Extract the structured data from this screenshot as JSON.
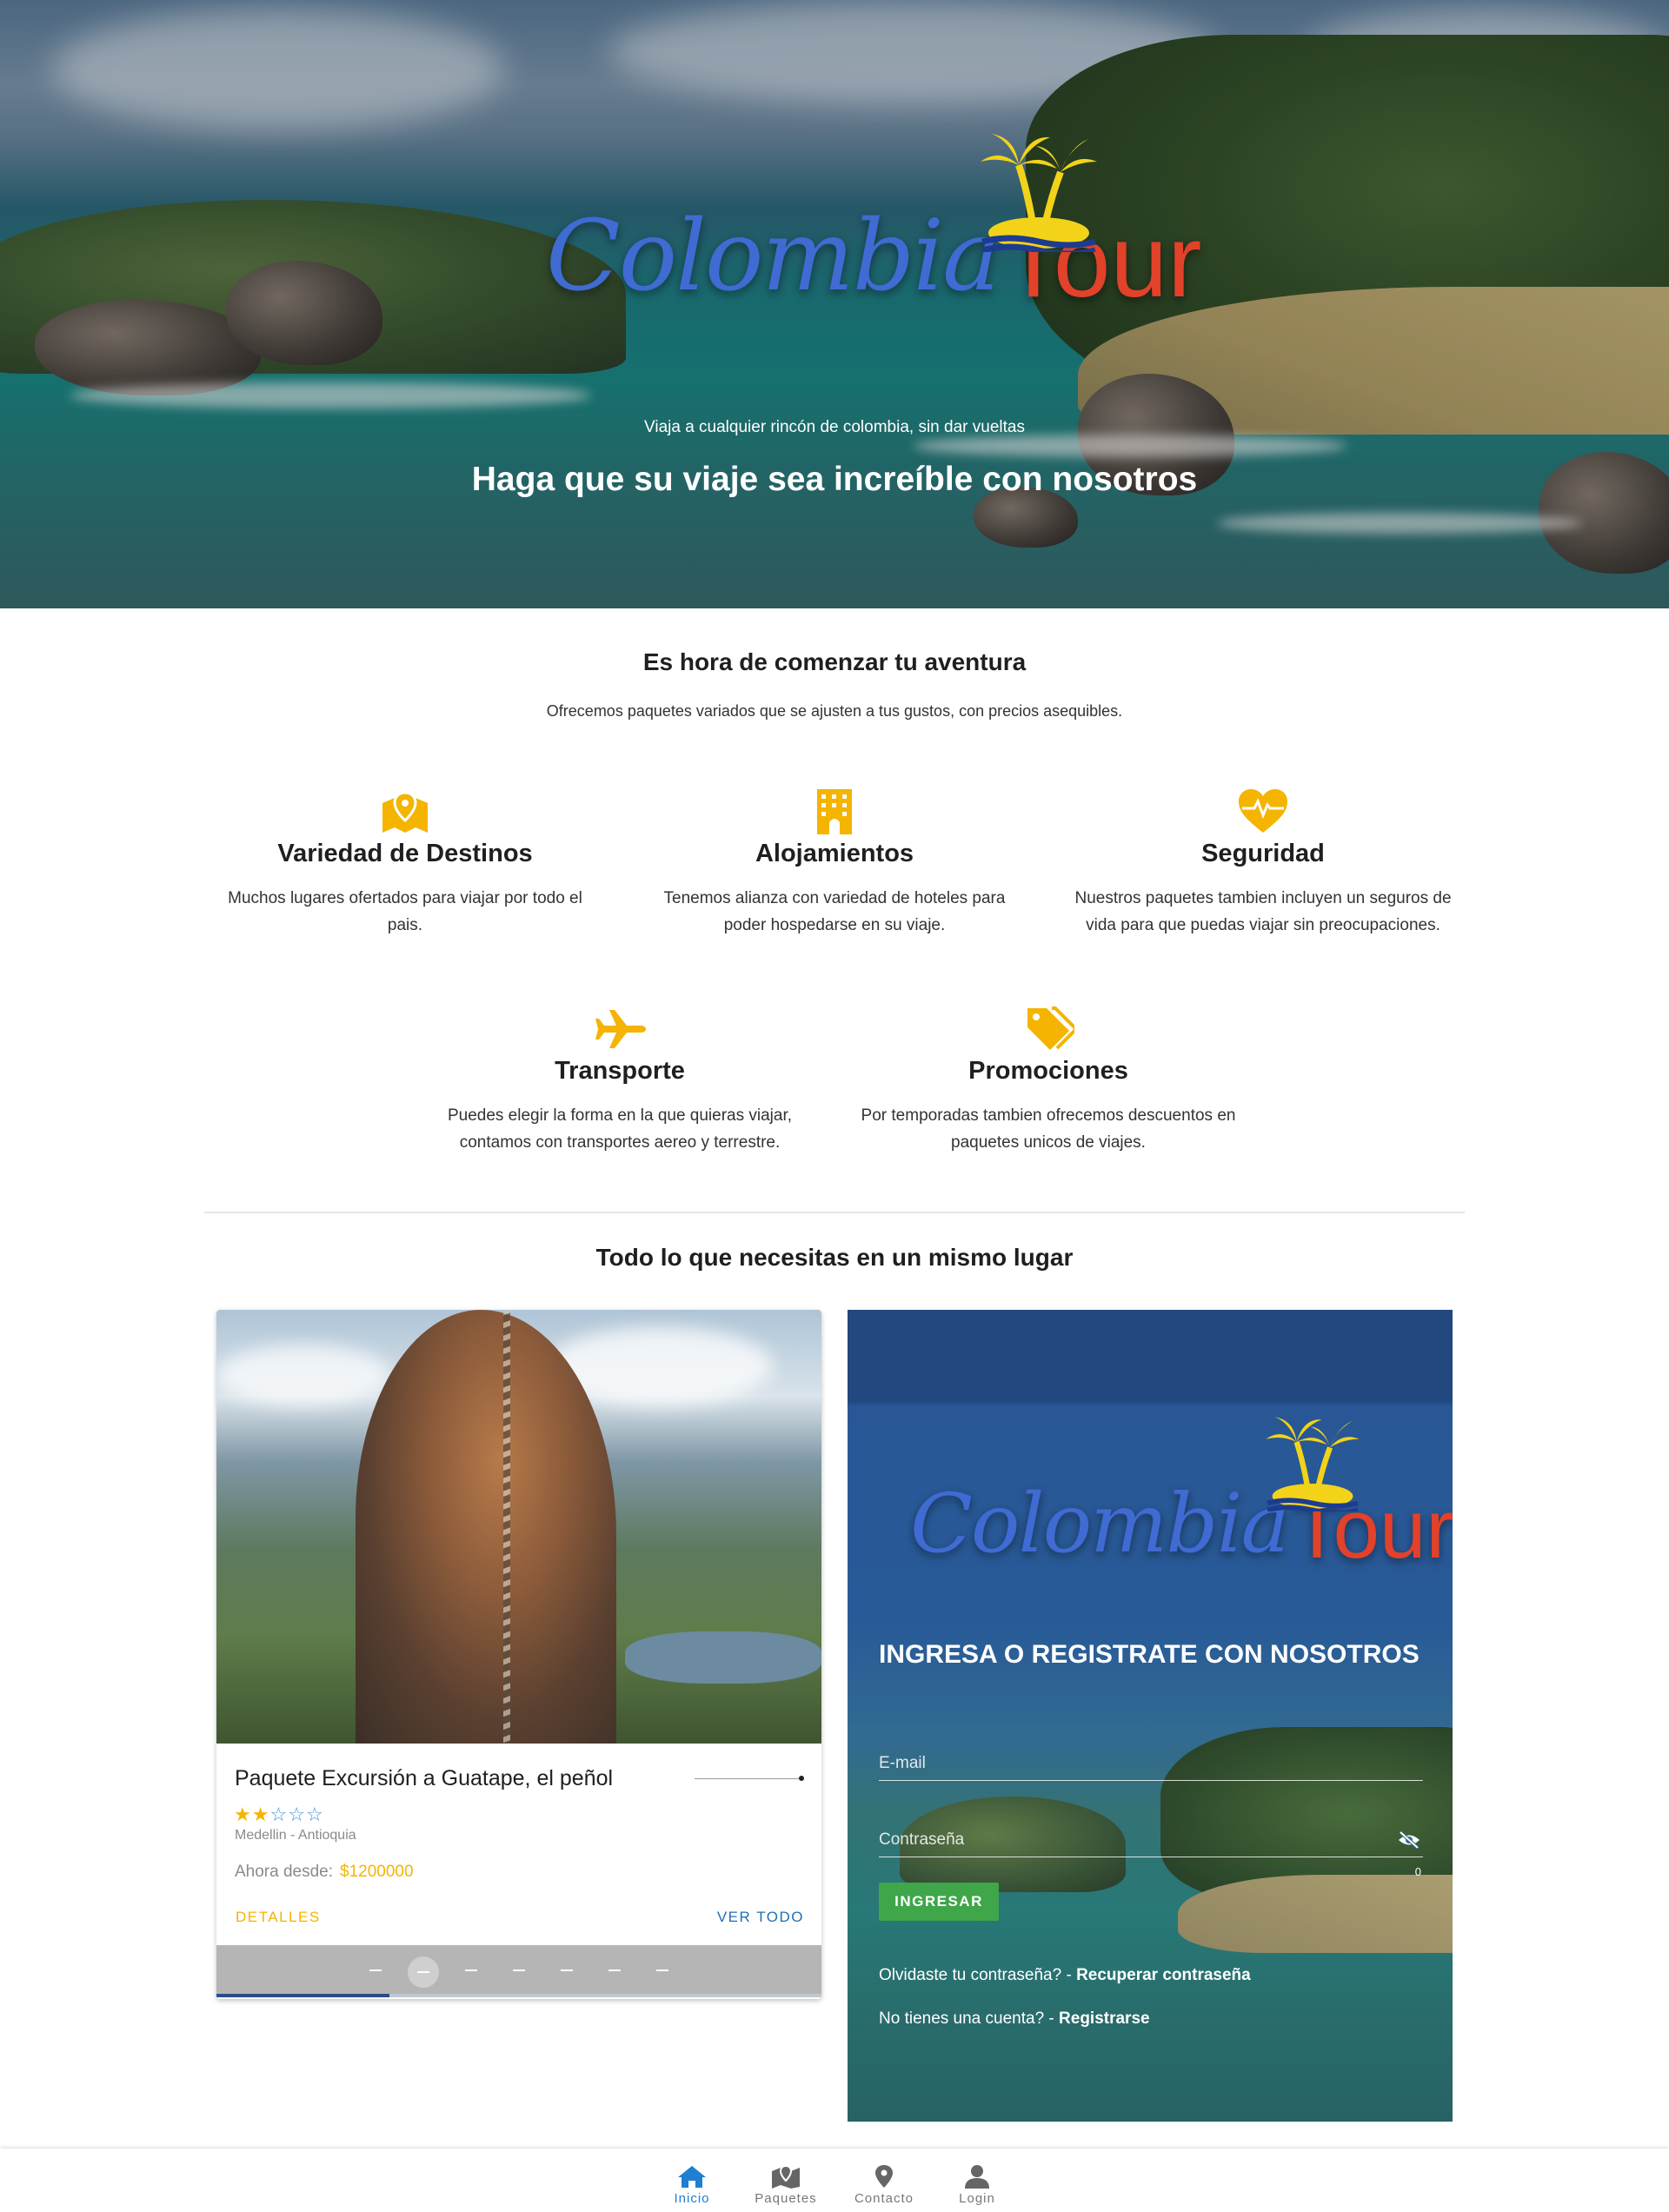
{
  "hero": {
    "logo": {
      "script": "Colombia",
      "tour": "Tour"
    },
    "tagline": "Viaja a cualquier rincón de colombia, sin dar vueltas",
    "headline": "Haga que su viaje sea increíble con nosotros"
  },
  "intro": {
    "title": "Es hora de comenzar tu aventura",
    "subtitle": "Ofrecemos paquetes variados que se ajusten a tus gustos, con precios asequibles."
  },
  "features": [
    {
      "icon": "map-pin-icon",
      "title": "Variedad de Destinos",
      "desc": "Muchos lugares ofertados para viajar por todo el pais."
    },
    {
      "icon": "hotel-icon",
      "title": "Alojamientos",
      "desc": "Tenemos alianza con variedad de hoteles para poder hospedarse en su viaje."
    },
    {
      "icon": "heart-pulse-icon",
      "title": "Seguridad",
      "desc": "Nuestros paquetes tambien incluyen un seguros de vida para que puedas viajar sin preocupaciones."
    },
    {
      "icon": "plane-icon",
      "title": "Transporte",
      "desc": "Puedes elegir la forma en la que quieras viajar, contamos con transportes aereo y terrestre."
    },
    {
      "icon": "tags-icon",
      "title": "Promociones",
      "desc": "Por temporadas tambien ofrecemos descuentos en paquetes unicos de viajes."
    }
  ],
  "packages": {
    "title": "Todo lo que necesitas en un mismo lugar",
    "card": {
      "name": "Paquete Excursión a Guatape, el peñol",
      "rating": 2,
      "rating_max": 5,
      "location": "Medellin - Antioquia",
      "price_label": "Ahora desde:",
      "price": "$1200000",
      "details_label": "DETALLES",
      "all_label": "VER TODO",
      "slides_total": 7,
      "slide_current": 2,
      "progress": 0.2857
    }
  },
  "login": {
    "logo": {
      "script": "Colombia",
      "tour": "Tour"
    },
    "title": "INGRESA O REGISTRATE CON NOSOTROS",
    "email_placeholder": "E-mail",
    "password_placeholder": "Contraseña",
    "password_counter": "0",
    "submit_label": "INGRESAR",
    "forgot_text": "Olvidaste tu contraseña? - ",
    "forgot_link": "Recuperar contraseña",
    "register_text": "No tienes una cuenta? - ",
    "register_link": "Registrarse"
  },
  "nav": {
    "items": [
      {
        "icon": "home-icon",
        "label": "Inicio",
        "active": true
      },
      {
        "icon": "map-icon",
        "label": "Paquetes",
        "active": false
      },
      {
        "icon": "location-pin-icon",
        "label": "Contacto",
        "active": false
      },
      {
        "icon": "user-icon",
        "label": "Login",
        "active": false
      }
    ]
  },
  "colors": {
    "accent": "#f4b400",
    "primary_blue": "#1f6fb5",
    "nav_active": "#1f7fd0",
    "login_button": "#3fa64a",
    "logo_blue": "#3f6bd2",
    "logo_red": "#e2412a"
  }
}
